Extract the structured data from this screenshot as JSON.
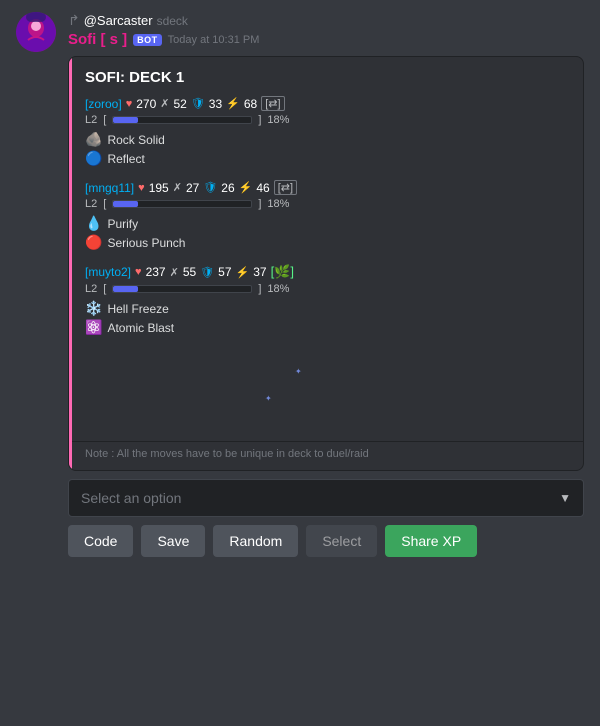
{
  "chat": {
    "reply_author": "@Sarcaster",
    "reply_command": "sdeck",
    "bot_name": "Sofi [ s ]",
    "bot_badge": "BOT",
    "timestamp": "Today at 10:31 PM",
    "deck_title": "SOFI: DECK 1",
    "cards": [
      {
        "name": "[zoroo]",
        "heart": "270",
        "sword": "52",
        "shield": "33",
        "lightning": "68",
        "level": "L2",
        "xp_pct": 18,
        "xp_label": "18%",
        "moves": [
          {
            "icon": "🪨",
            "name": "Rock Solid"
          },
          {
            "icon": "🔵",
            "name": "Reflect"
          }
        ]
      },
      {
        "name": "[mngq11]",
        "heart": "195",
        "sword": "27",
        "shield": "26",
        "lightning": "46",
        "level": "L2",
        "xp_pct": 18,
        "xp_label": "18%",
        "moves": [
          {
            "icon": "💧",
            "name": "Purify"
          },
          {
            "icon": "🔴",
            "name": "Serious Punch"
          }
        ]
      },
      {
        "name": "[muyto2]",
        "heart": "237",
        "sword": "55",
        "shield": "57",
        "lightning": "37",
        "level": "L2",
        "xp_pct": 18,
        "xp_label": "18%",
        "special_icon": "🌿",
        "moves": [
          {
            "icon": "❄️",
            "name": "Hell Freeze"
          },
          {
            "icon": "⚛️",
            "name": "Atomic Blast"
          }
        ]
      }
    ],
    "note": "Note : All the moves have to be unique in deck to duel/raid",
    "select_placeholder": "Select an option",
    "buttons": [
      {
        "id": "code",
        "label": "Code",
        "type": "secondary"
      },
      {
        "id": "save",
        "label": "Save",
        "type": "secondary"
      },
      {
        "id": "random",
        "label": "Random",
        "type": "secondary"
      },
      {
        "id": "select",
        "label": "Select",
        "type": "disabled"
      },
      {
        "id": "share_xp",
        "label": "Share XP",
        "type": "primary"
      }
    ]
  }
}
